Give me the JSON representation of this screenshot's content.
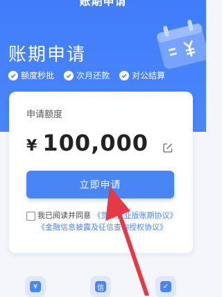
{
  "nav": {
    "title": "账期申请"
  },
  "hero": {
    "title": "账期申请",
    "features": [
      "额度秒批",
      "次月还款",
      "对公结算"
    ]
  },
  "card": {
    "quota_label": "申请额度",
    "currency": "¥",
    "amount": "100,000",
    "apply_label": "立即申请",
    "agree_prefix": "我已阅读并同意",
    "agree_link1": "《货款企业版账期协议》",
    "agree_link2": "《金融信息披露及征信查询授权协议》"
  },
  "bottom": {
    "icons": [
      {
        "name": "yen-icon",
        "glyph": "¥"
      },
      {
        "name": "credit-icon",
        "glyph": "信"
      },
      {
        "name": "calendar-check-icon",
        "glyph": "✓"
      }
    ]
  },
  "colors": {
    "primary": "#4a85f6",
    "hero": "#3f7dfb",
    "annotation": "#e53946"
  }
}
